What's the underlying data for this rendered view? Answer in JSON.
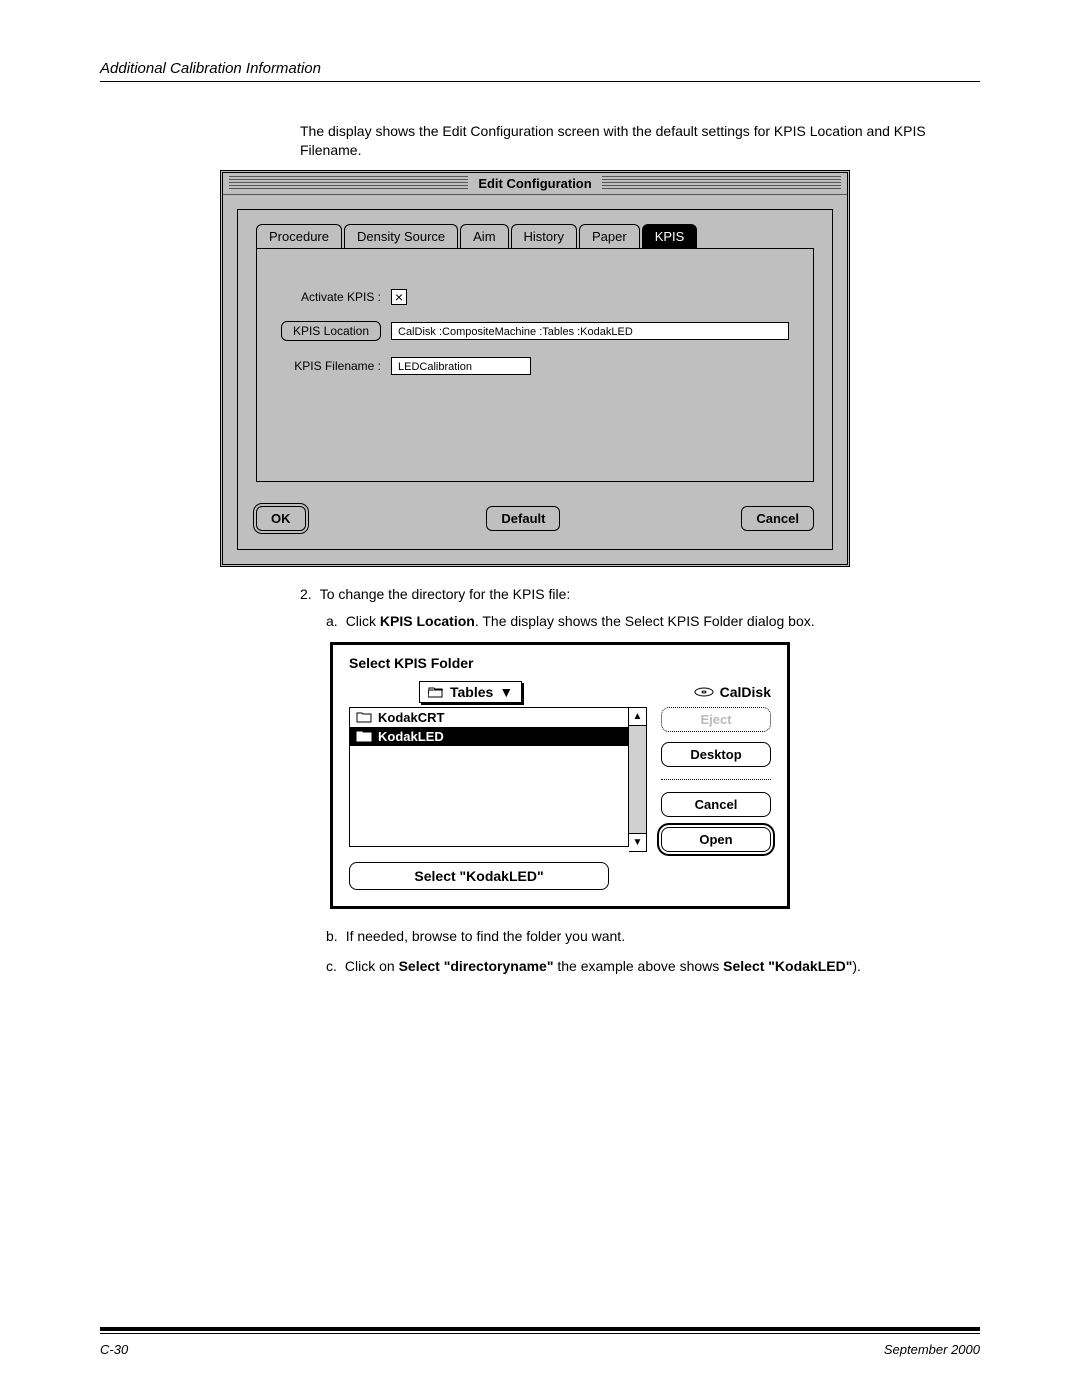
{
  "header": {
    "title": "Additional Calibration Information"
  },
  "intro": "The display shows the Edit Configuration screen with the default settings for KPIS Location and KPIS Filename.",
  "editConfig": {
    "title": "Edit Configuration",
    "tabs": [
      "Procedure",
      "Density Source",
      "Aim",
      "History",
      "Paper",
      "KPIS"
    ],
    "activeTab": "KPIS",
    "activateLabel": "Activate KPIS :",
    "activateChecked": "×",
    "locationLabel": "KPIS Location",
    "locationValue": "CalDisk :CompositeMachine :Tables :KodakLED",
    "filenameLabel": "KPIS Filename :",
    "filenameValue": "LEDCalibration",
    "buttons": {
      "ok": "OK",
      "default": "Default",
      "cancel": "Cancel"
    }
  },
  "step2": {
    "num": "2.",
    "text": "To change the directory for the KPIS file:",
    "a": {
      "letter": "a.",
      "pre": "Click ",
      "bold": "KPIS Location",
      "post": ". The display shows the Select KPIS Folder dialog box."
    },
    "b": {
      "letter": "b.",
      "text": "If needed, browse to find the folder you want."
    },
    "c": {
      "letter": "c.",
      "pre": "Click on ",
      "bold1": "Select \"directoryname\"",
      "mid": " the example above shows ",
      "bold2": "Select \"KodakLED\"",
      "post": ")."
    }
  },
  "folderDialog": {
    "title": "Select KPIS Folder",
    "dropdown": "Tables",
    "disk": "CalDisk",
    "items": [
      {
        "name": "KodakCRT",
        "selected": false
      },
      {
        "name": "KodakLED",
        "selected": true
      }
    ],
    "buttons": {
      "eject": "Eject",
      "desktop": "Desktop",
      "cancel": "Cancel",
      "open": "Open"
    },
    "selectBtn": "Select \"KodakLED\""
  },
  "footer": {
    "pageNum": "C-30",
    "date": "September 2000"
  }
}
